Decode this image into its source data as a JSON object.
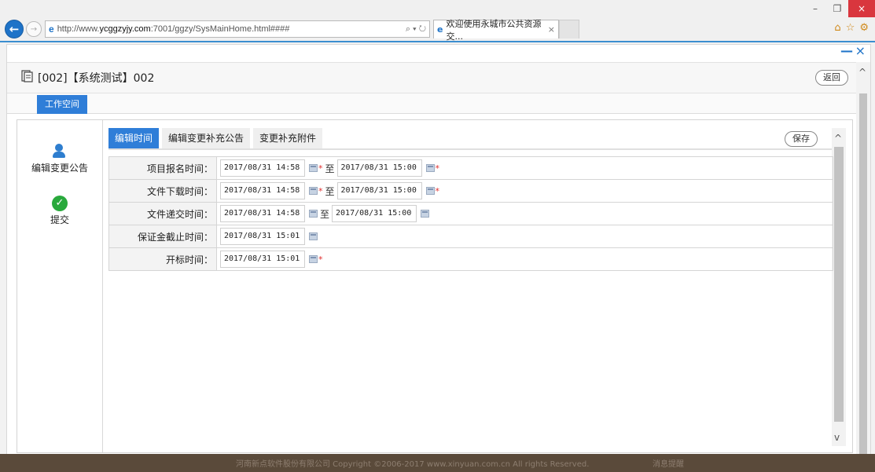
{
  "browser": {
    "url_prefix": "http://www.",
    "url_host": "ycggzyjy.com",
    "url_rest": ":7001/ggzy/SysMainHome.html####",
    "address_tools": "⌕ ▾ ↻",
    "tab_title": "欢迎使用永城市公共资源交...",
    "tab_close": "×",
    "min": "–",
    "restore": "❐",
    "close": "×",
    "right_icons": [
      "⌂",
      "☆",
      "⚙"
    ]
  },
  "modal": {
    "minimize": "—",
    "close": "×",
    "title": "[002]【系统测试】002",
    "back_button": "返回",
    "workspace_tab": "工作空间"
  },
  "sidebar": {
    "items": [
      {
        "label": "编辑变更公告",
        "icon": "person-edit-icon"
      },
      {
        "label": "提交",
        "icon": "check-circle-icon"
      }
    ]
  },
  "tabs": {
    "items": [
      "编辑时间",
      "编辑变更补充公告",
      "变更补充附件"
    ],
    "active": 0,
    "save_button": "保存"
  },
  "form": {
    "separator": "至",
    "rows": [
      {
        "label": "项目报名时间：",
        "start": "2017/08/31 14:58",
        "start_required": true,
        "end": "2017/08/31 15:00",
        "end_required": true
      },
      {
        "label": "文件下载时间：",
        "start": "2017/08/31 14:58",
        "start_required": true,
        "end": "2017/08/31 15:00",
        "end_required": true
      },
      {
        "label": "文件递交时间：",
        "start": "2017/08/31 14:58",
        "start_required": false,
        "end": "2017/08/31 15:00",
        "end_required": false
      },
      {
        "label": "保证金截止时间：",
        "start": "2017/08/31 15:01",
        "start_required": false
      },
      {
        "label": "开标时间：",
        "start": "2017/08/31 15:01",
        "start_required": true
      }
    ]
  },
  "footer": {
    "copyright": "河南新点软件股份有限公司 Copyright ©2006-2017 www.xinyuan.com.cn All rights Reserved.",
    "message": "消息提醒"
  }
}
